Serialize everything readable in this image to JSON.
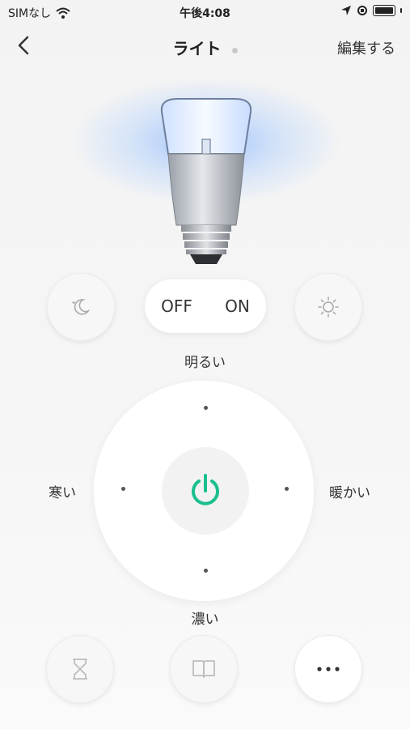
{
  "status_bar": {
    "carrier": "SIMなし",
    "time": "午後4:08"
  },
  "nav": {
    "title": "ライト",
    "edit_label": "編集する"
  },
  "toggle": {
    "off_label": "OFF",
    "on_label": "ON"
  },
  "dial_labels": {
    "top": "明るい",
    "bottom": "濃い",
    "left": "寒い",
    "right": "暖かい"
  },
  "colors": {
    "accent": "#1bbf8f",
    "glow": "#8fb8ff"
  },
  "icons": {
    "back": "chevron-left-icon",
    "night_mode": "moon-icon",
    "day_mode": "sun-icon",
    "power": "power-icon",
    "timer": "hourglass-icon",
    "guide": "book-icon",
    "more": "more-icon"
  }
}
